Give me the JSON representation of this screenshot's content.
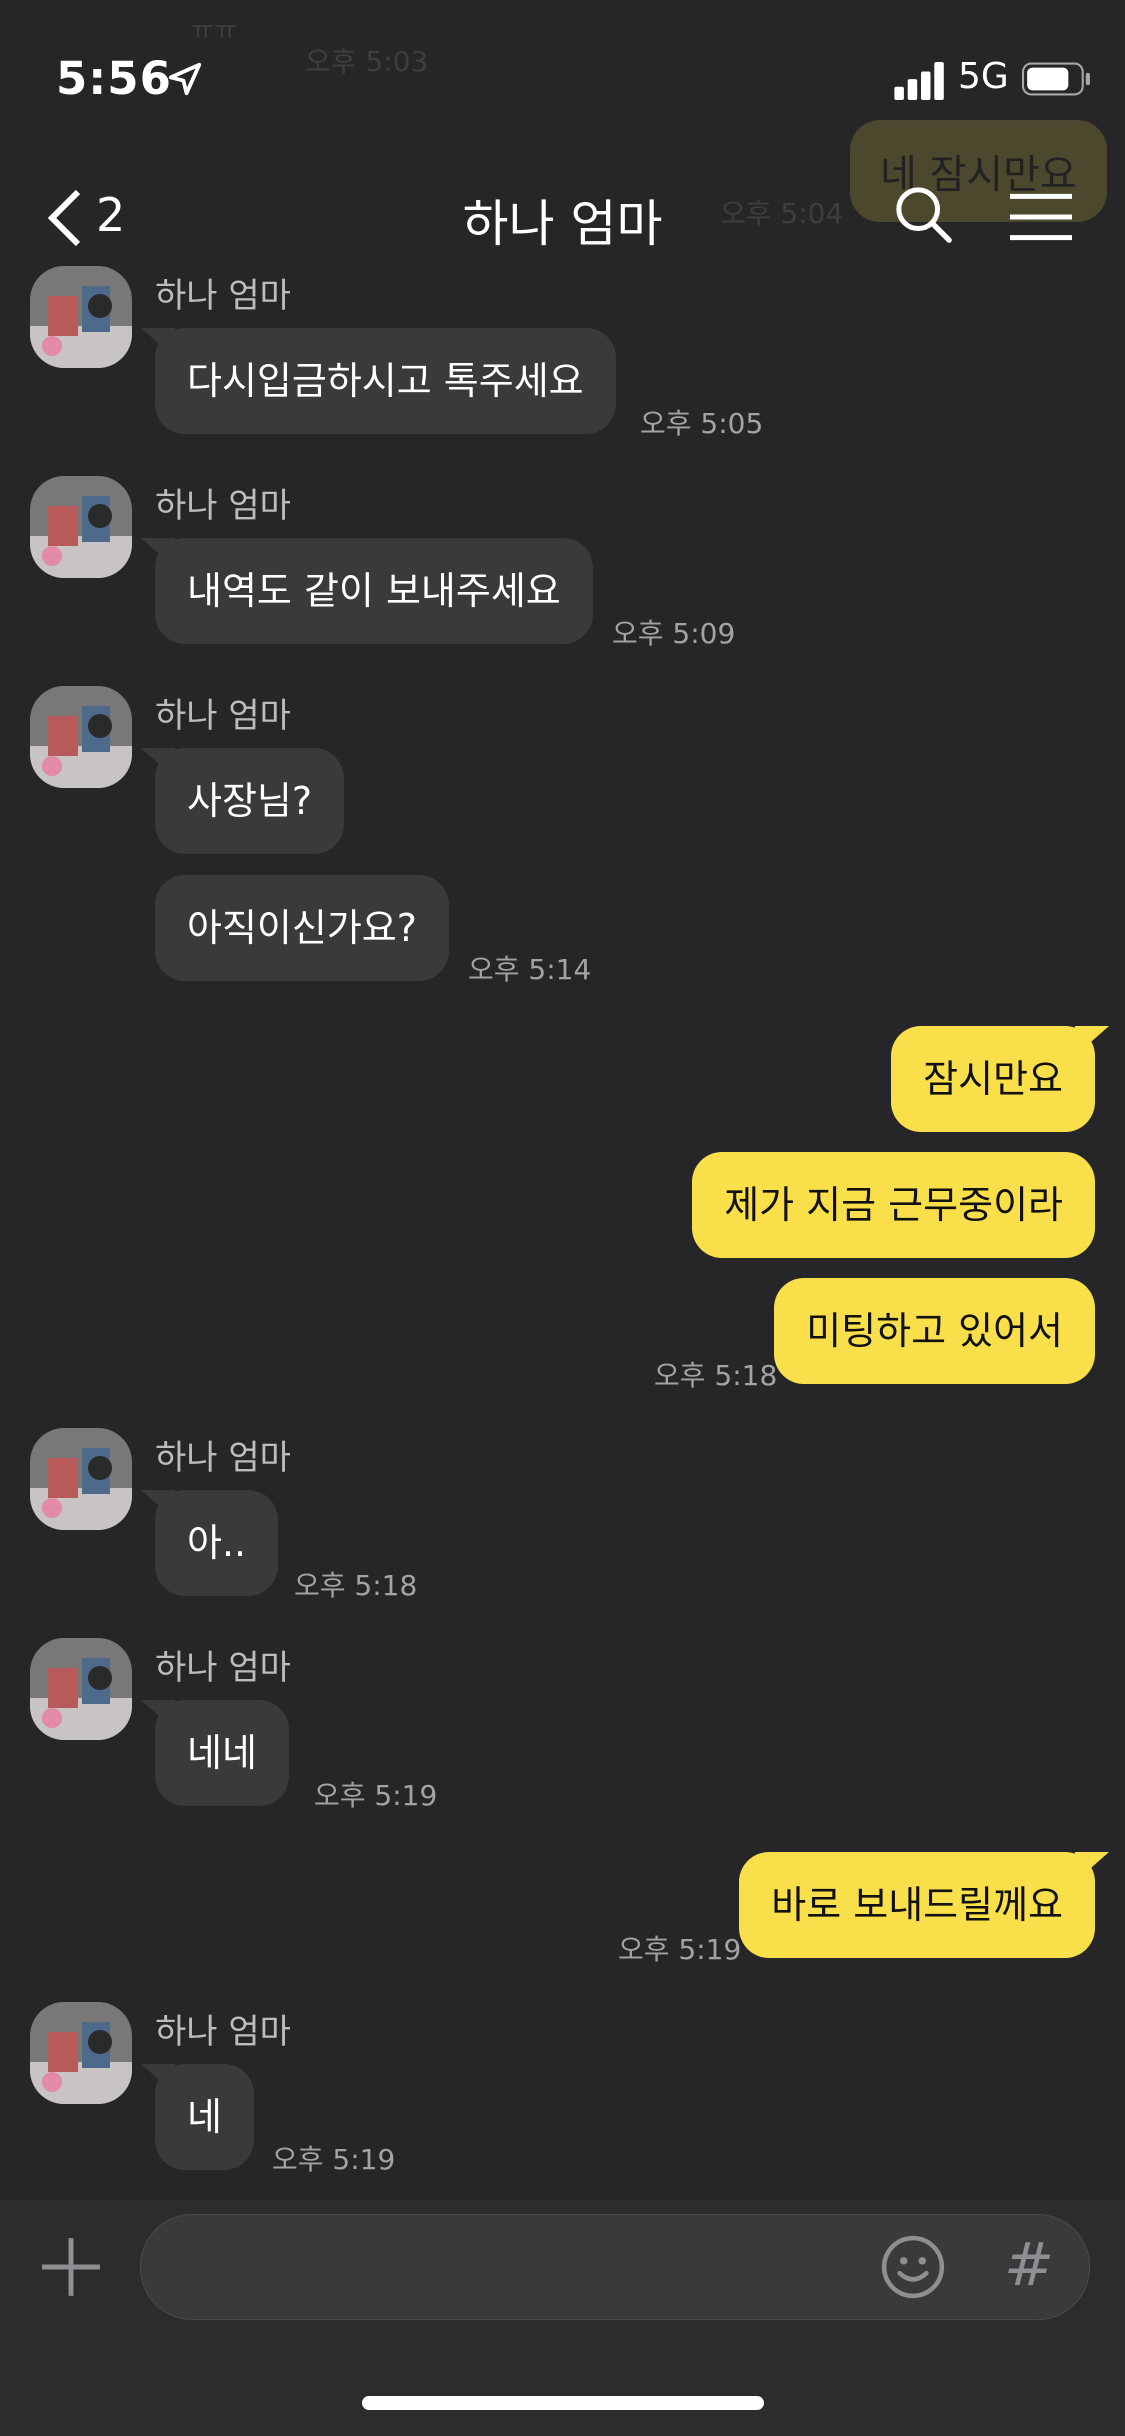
{
  "status": {
    "time": "5:56",
    "network": "5G"
  },
  "ghost": {
    "bubble": "네 잠시만요",
    "time": "오후 5:04",
    "top_text": "ㅠㅠ",
    "top_time": "오후 5:03"
  },
  "nav": {
    "back_count": "2",
    "title": "하나 엄마"
  },
  "messages": [
    {
      "sender": "하나 엄마",
      "text": "다시입금하시고 톡주세요",
      "time": "오후 5:05"
    },
    {
      "sender": "하나 엄마",
      "text": "내역도 같이 보내주세요",
      "time": "오후 5:09"
    },
    {
      "sender": "하나 엄마",
      "text": "사장님?",
      "text2": "아직이신가요?",
      "time": "오후 5:14"
    },
    {
      "text": "잠시만요",
      "text2": "제가 지금 근무중이라",
      "text3": "미팅하고 있어서",
      "time": "오후 5:18"
    },
    {
      "sender": "하나 엄마",
      "text": "아..",
      "time": "오후 5:18"
    },
    {
      "sender": "하나 엄마",
      "text": "네네",
      "time": "오후 5:19"
    },
    {
      "text": "바로 보내드릴께요",
      "time": "오후 5:19"
    },
    {
      "sender": "하나 엄마",
      "text": "네",
      "time": "오후 5:19"
    }
  ],
  "input": {
    "hash_label": "#",
    "icons": [
      "plus-icon",
      "emoji-icon",
      "hash-icon"
    ]
  },
  "colors": {
    "background": "#262628",
    "incoming_bubble": "#3a3a3c",
    "outgoing_bubble": "#f9e04b"
  }
}
